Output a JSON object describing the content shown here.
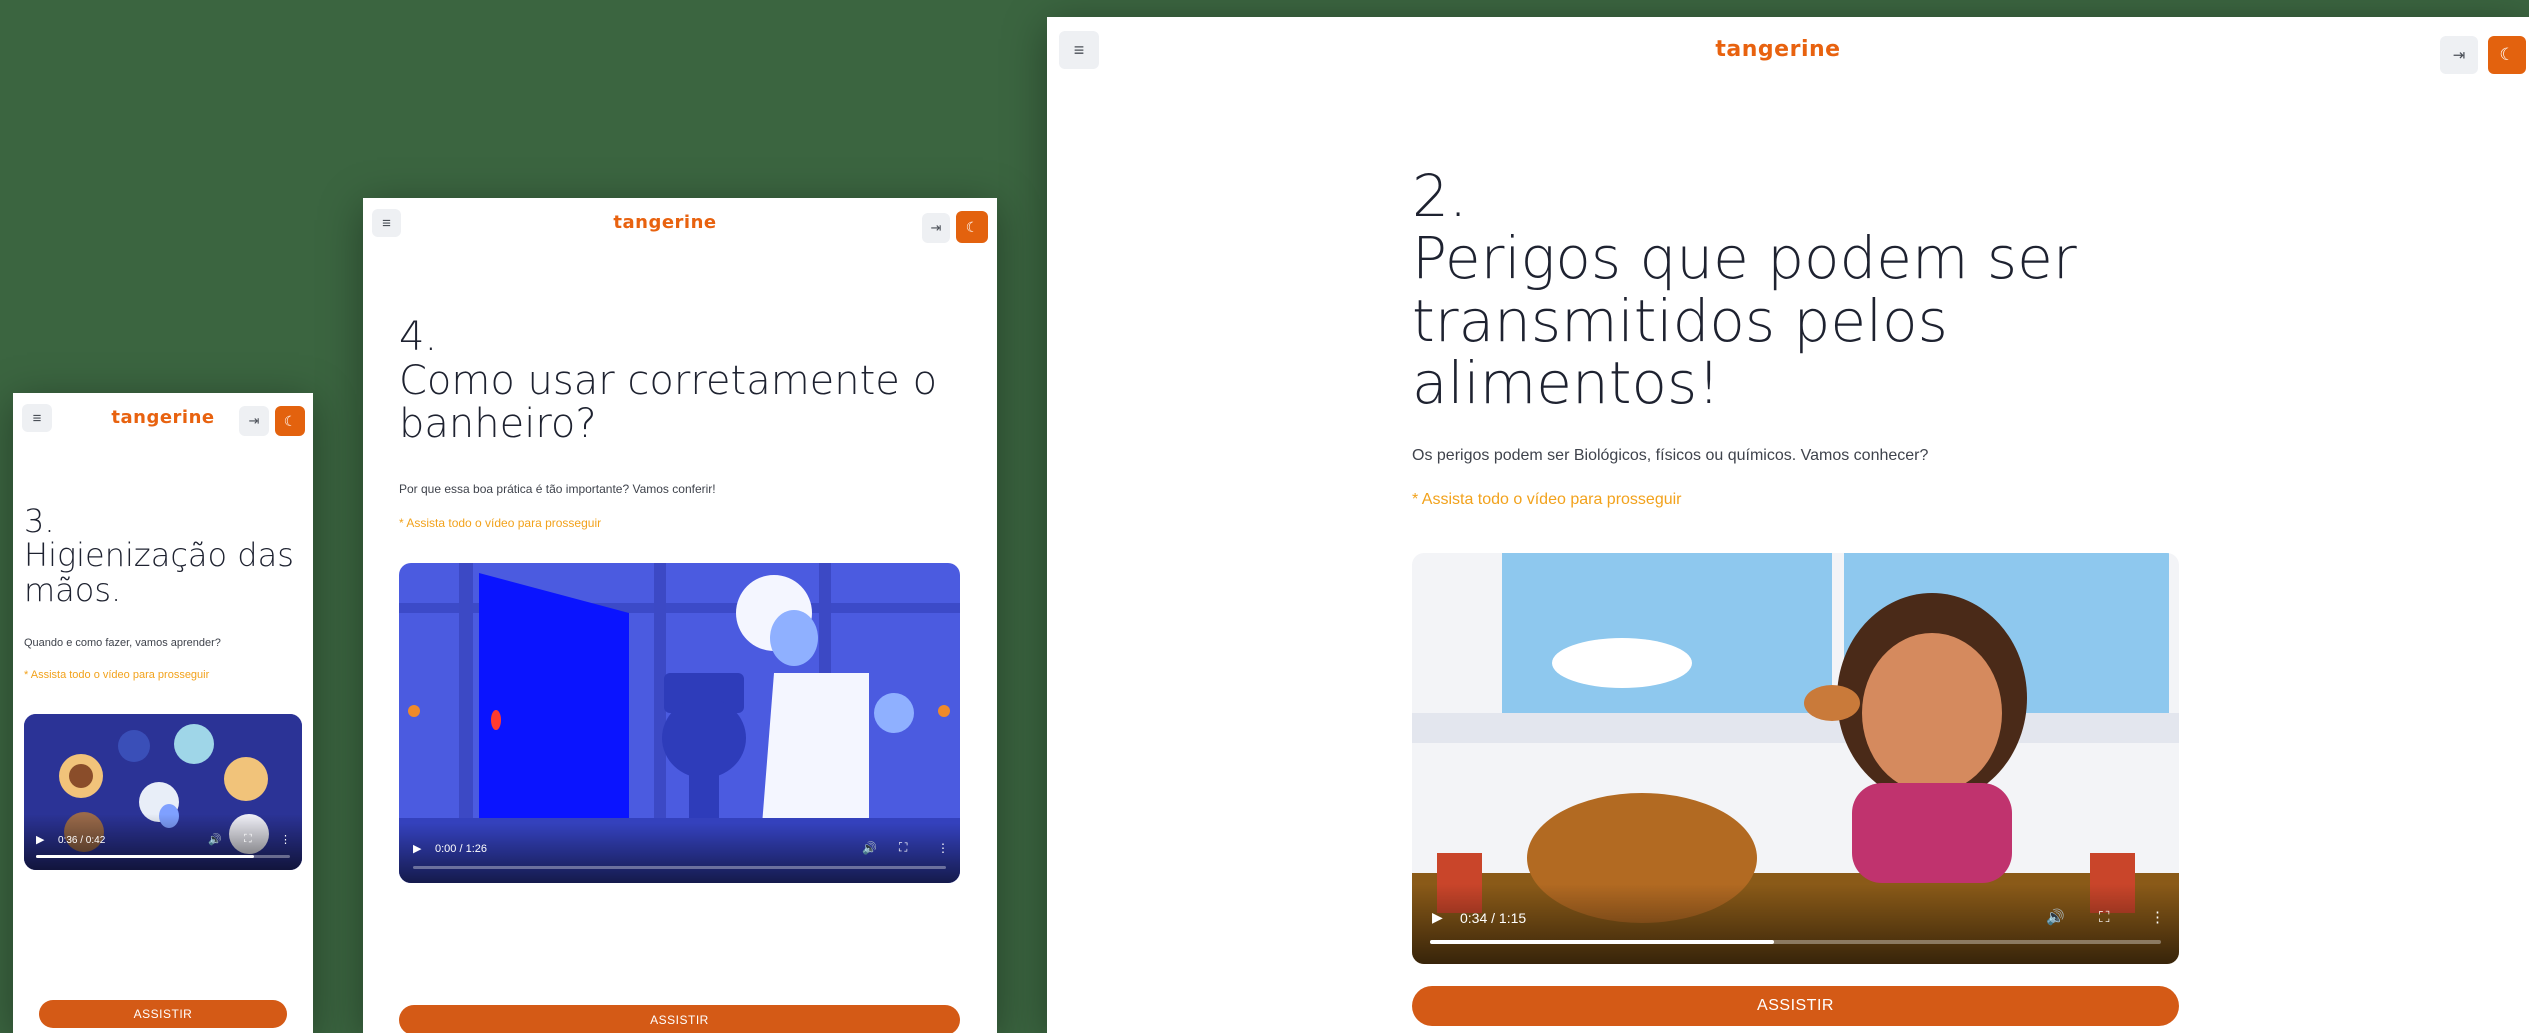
{
  "colors": {
    "background": "#3b6540",
    "brand": "#e8620f",
    "accent_button": "#d45a16",
    "note": "#f2a21c",
    "icon_button_bg": "#eef0f3"
  },
  "screens": [
    {
      "brand": "tangerine",
      "step": "3.",
      "title": "Higienização das mãos.",
      "description": "Quando e como fazer, vamos aprender?",
      "note": "* Assista todo o vídeo para prosseguir",
      "video": {
        "time": "0:36 / 0:42",
        "progress": 0.86
      },
      "cta": "ASSISTIR",
      "icons": {
        "menu": "menu-icon",
        "login": "login-icon",
        "theme": "moon-icon"
      }
    },
    {
      "brand": "tangerine",
      "step": "4.",
      "title": "Como usar corretamente o banheiro?",
      "description": "Por que essa boa prática é tão importante? Vamos conferir!",
      "note": "* Assista todo o vídeo para prosseguir",
      "video": {
        "time": "0:00 / 1:26",
        "progress": 0.0
      },
      "cta": "ASSISTIR",
      "icons": {
        "menu": "menu-icon",
        "login": "login-icon",
        "theme": "moon-icon"
      }
    },
    {
      "brand": "tangerine",
      "step": "2.",
      "title": "Perigos que podem ser transmitidos pelos alimentos!",
      "description": "Os perigos podem ser Biológicos, físicos ou químicos. Vamos conhecer?",
      "note": "* Assista todo o vídeo para prosseguir",
      "video": {
        "time": "0:34 / 1:15",
        "progress": 0.47
      },
      "cta": "ASSISTIR",
      "icons": {
        "menu": "menu-icon",
        "login": "login-icon",
        "theme": "moon-icon"
      }
    }
  ]
}
